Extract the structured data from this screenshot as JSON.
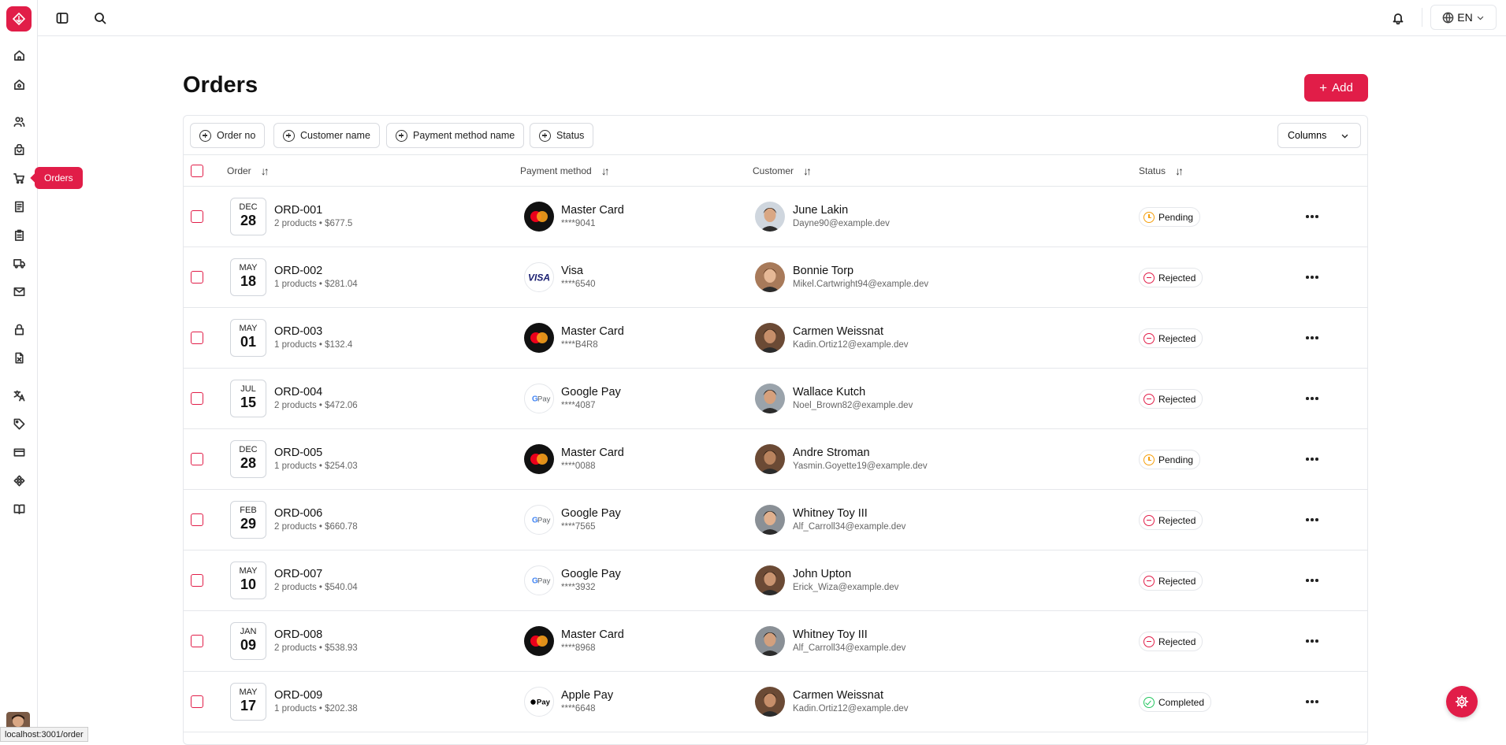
{
  "app": {
    "status_url": "localhost:3001/order"
  },
  "sidebar": {
    "tooltip": "Orders",
    "icons": [
      "home-icon",
      "building-icon",
      "users-icon",
      "package-icon",
      "cart-icon",
      "receipt-icon",
      "clipboard-icon",
      "truck-icon",
      "mail-icon",
      "lock-icon",
      "file-x-icon",
      "translate-icon",
      "tag-icon",
      "credit-card-icon",
      "components-icon",
      "book-icon"
    ]
  },
  "topbar": {
    "language": "EN"
  },
  "page": {
    "title": "Orders",
    "add_label": "Add"
  },
  "filters": {
    "order_no": "Order no",
    "customer_name": "Customer name",
    "payment_method_name": "Payment method name",
    "status": "Status",
    "columns": "Columns"
  },
  "columns": {
    "order": "Order",
    "payment": "Payment method",
    "customer": "Customer",
    "status": "Status"
  },
  "colors": {
    "accent": "#e11d48",
    "pending": "#f59e0b",
    "completed": "#22c55e"
  },
  "rows": [
    {
      "mon": "DEC",
      "day": "28",
      "id": "ORD-001",
      "summary": "2 products • $677.5",
      "pay": "Master Card",
      "card": "****9041",
      "pay_type": "mastercard",
      "name": "June Lakin",
      "email": "Dayne90@example.dev",
      "status": "Pending",
      "status_type": "pending"
    },
    {
      "mon": "MAY",
      "day": "18",
      "id": "ORD-002",
      "summary": "1 products • $281.04",
      "pay": "Visa",
      "card": "****6540",
      "pay_type": "visa",
      "name": "Bonnie Torp",
      "email": "Mikel.Cartwright94@example.dev",
      "status": "Rejected",
      "status_type": "rejected"
    },
    {
      "mon": "MAY",
      "day": "01",
      "id": "ORD-003",
      "summary": "1 products • $132.4",
      "pay": "Master Card",
      "card": "****B4R8",
      "pay_type": "mastercard",
      "name": "Carmen Weissnat",
      "email": "Kadin.Ortiz12@example.dev",
      "status": "Rejected",
      "status_type": "rejected"
    },
    {
      "mon": "JUL",
      "day": "15",
      "id": "ORD-004",
      "summary": "2 products • $472.06",
      "pay": "Google Pay",
      "card": "****4087",
      "pay_type": "gpay",
      "name": "Wallace Kutch",
      "email": "Noel_Brown82@example.dev",
      "status": "Rejected",
      "status_type": "rejected"
    },
    {
      "mon": "DEC",
      "day": "28",
      "id": "ORD-005",
      "summary": "1 products • $254.03",
      "pay": "Master Card",
      "card": "****0088",
      "pay_type": "mastercard",
      "name": "Andre Stroman",
      "email": "Yasmin.Goyette19@example.dev",
      "status": "Pending",
      "status_type": "pending"
    },
    {
      "mon": "FEB",
      "day": "29",
      "id": "ORD-006",
      "summary": "2 products • $660.78",
      "pay": "Google Pay",
      "card": "****7565",
      "pay_type": "gpay",
      "name": "Whitney Toy III",
      "email": "Alf_Carroll34@example.dev",
      "status": "Rejected",
      "status_type": "rejected"
    },
    {
      "mon": "MAY",
      "day": "10",
      "id": "ORD-007",
      "summary": "2 products • $540.04",
      "pay": "Google Pay",
      "card": "****3932",
      "pay_type": "gpay",
      "name": "John Upton",
      "email": "Erick_Wiza@example.dev",
      "status": "Rejected",
      "status_type": "rejected"
    },
    {
      "mon": "JAN",
      "day": "09",
      "id": "ORD-008",
      "summary": "2 products • $538.93",
      "pay": "Master Card",
      "card": "****8968",
      "pay_type": "mastercard",
      "name": "Whitney Toy III",
      "email": "Alf_Carroll34@example.dev",
      "status": "Rejected",
      "status_type": "rejected"
    },
    {
      "mon": "MAY",
      "day": "17",
      "id": "ORD-009",
      "summary": "1 products • $202.38",
      "pay": "Apple Pay",
      "card": "****6648",
      "pay_type": "applepay",
      "name": "Carmen Weissnat",
      "email": "Kadin.Ortiz12@example.dev",
      "status": "Completed",
      "status_type": "completed"
    }
  ]
}
